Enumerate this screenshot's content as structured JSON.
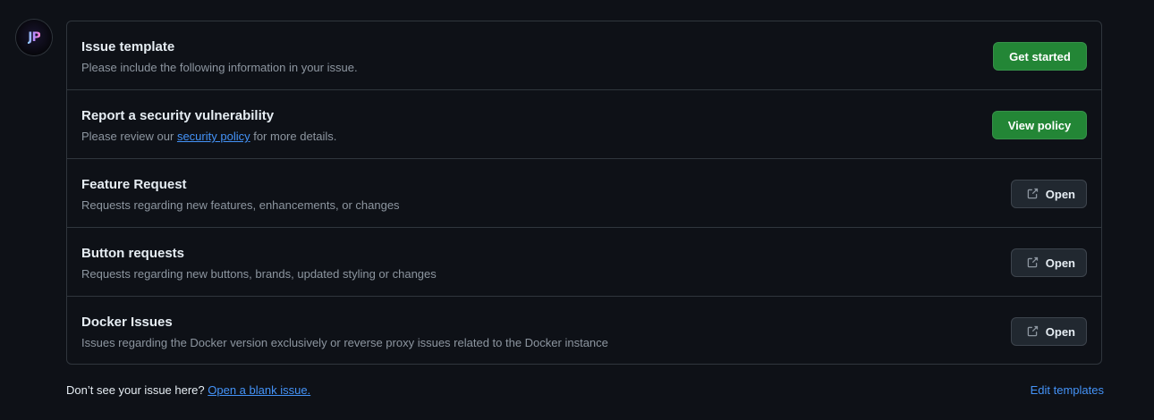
{
  "user": {
    "avatar_initials": "JP"
  },
  "templates": [
    {
      "title": "Issue template",
      "description": "Please include the following information in your issue.",
      "button_label": "Get started"
    },
    {
      "title": "Report a security vulnerability",
      "description_before": "Please review our ",
      "description_link": "security policy",
      "description_after": " for more details.",
      "button_label": "View policy"
    },
    {
      "title": "Feature Request",
      "description": "Requests regarding new features, enhancements, or changes",
      "button_label": "Open",
      "button_icon": "external-link-icon"
    },
    {
      "title": "Button requests",
      "description": "Requests regarding new buttons, brands, updated styling or changes",
      "button_label": "Open",
      "button_icon": "external-link-icon"
    },
    {
      "title": "Docker Issues",
      "description": "Issues regarding the Docker version exclusively or reverse proxy issues related to the Docker instance",
      "button_label": "Open",
      "button_icon": "external-link-icon"
    }
  ],
  "footer": {
    "prompt": "Don’t see your issue here? ",
    "blank_issue_link": "Open a blank issue.",
    "edit_templates_link": "Edit templates"
  },
  "colors": {
    "background": "#0e1117",
    "border": "#30363d",
    "primary_button": "#238636",
    "link": "#4493f8",
    "muted_text": "#8d96a0"
  }
}
